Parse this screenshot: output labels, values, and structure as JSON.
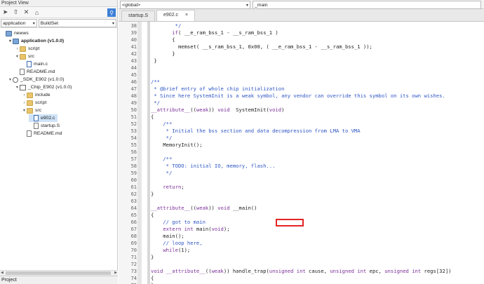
{
  "left": {
    "title": "Project View",
    "combo1": "application",
    "combo2": "BuildSet",
    "bottom_title": "Project",
    "tree": [
      {
        "label": "newws",
        "icon": "workspace",
        "indent": 0,
        "twist": "",
        "bold": false
      },
      {
        "label": "application (v1.0.0)",
        "icon": "project",
        "indent": 1,
        "twist": "▾",
        "bold": true
      },
      {
        "label": "script",
        "icon": "folder",
        "indent": 2,
        "twist": "›",
        "bold": false
      },
      {
        "label": "src",
        "icon": "folder",
        "indent": 2,
        "twist": "▾",
        "bold": false
      },
      {
        "label": "main.c",
        "icon": "cfile",
        "indent": 3,
        "twist": "",
        "bold": false
      },
      {
        "label": "README.md",
        "icon": "file",
        "indent": 2,
        "twist": "",
        "bold": false
      },
      {
        "label": "_SDK_E902 (v1.0.0)",
        "icon": "gear",
        "indent": 1,
        "twist": "▾",
        "bold": false
      },
      {
        "label": "_Chip_E902 (v1.0.0)",
        "icon": "chip",
        "indent": 2,
        "twist": "▾",
        "bold": false
      },
      {
        "label": "include",
        "icon": "folder",
        "indent": 3,
        "twist": "›",
        "bold": false
      },
      {
        "label": "script",
        "icon": "folder",
        "indent": 3,
        "twist": "›",
        "bold": false
      },
      {
        "label": "src",
        "icon": "folder",
        "indent": 3,
        "twist": "▾",
        "bold": false
      },
      {
        "label": "e902.c",
        "icon": "cfile",
        "indent": 4,
        "twist": "",
        "bold": false,
        "selected": true
      },
      {
        "label": "startup.S",
        "icon": "file",
        "indent": 4,
        "twist": "",
        "bold": false
      },
      {
        "label": "README.md",
        "icon": "file",
        "indent": 3,
        "twist": "",
        "bold": false
      }
    ]
  },
  "editor": {
    "scope_combo": "<global>",
    "symbol_combo": "_main",
    "tabs": [
      {
        "label": "startup.S",
        "active": false,
        "closable": false
      },
      {
        "label": "e902.c",
        "active": true,
        "closable": true
      }
    ],
    "close_glyph": "×",
    "lines": [
      {
        "n": "38",
        "html": "        */"
      },
      {
        "n": "39",
        "html": "       if( __e_ram_bss_1 - __s_ram_bss_1 )"
      },
      {
        "n": "40",
        "html": "       {"
      },
      {
        "n": "41",
        "html": "         memset( __s_ram_bss_1, 0x00, ( __e_ram_bss_1 - __s_ram_bss_1 ));"
      },
      {
        "n": "42",
        "html": "       }"
      },
      {
        "n": "43",
        "html": " }"
      },
      {
        "n": "44",
        "html": ""
      },
      {
        "n": "45",
        "html": ""
      },
      {
        "n": "46",
        "html": "/**"
      },
      {
        "n": "47",
        "html": " * @brief entry of whole chip initialization"
      },
      {
        "n": "48",
        "html": " * Since here SystemInit is a weak symbol, any vendor can override this symbol on its own wishes."
      },
      {
        "n": "49",
        "html": " */"
      },
      {
        "n": "50",
        "html": "__attribute__((weak)) void  SystemInit(void)"
      },
      {
        "n": "51",
        "html": "{"
      },
      {
        "n": "52",
        "html": "    /**"
      },
      {
        "n": "53",
        "html": "     * Initial the bss section and data decompression from LMA to VMA"
      },
      {
        "n": "54",
        "html": "     */"
      },
      {
        "n": "55",
        "html": "    MemoryInit();"
      },
      {
        "n": "56",
        "html": ""
      },
      {
        "n": "57",
        "html": "    /**"
      },
      {
        "n": "58",
        "html": "     * TODO: initial IO, memory, flash..."
      },
      {
        "n": "59",
        "html": "     */"
      },
      {
        "n": "60",
        "html": ""
      },
      {
        "n": "61",
        "html": "    return;"
      },
      {
        "n": "62",
        "html": "}"
      },
      {
        "n": "63",
        "html": ""
      },
      {
        "n": "64",
        "html": "__attribute__((weak)) void __main()"
      },
      {
        "n": "65",
        "html": "{"
      },
      {
        "n": "66",
        "html": "    // got to main"
      },
      {
        "n": "67",
        "html": "    extern int main(void);"
      },
      {
        "n": "68",
        "html": "    main();"
      },
      {
        "n": "69",
        "html": "    // loop here,"
      },
      {
        "n": "70",
        "html": "    while(1);"
      },
      {
        "n": "71",
        "html": "}"
      },
      {
        "n": "72",
        "html": ""
      },
      {
        "n": "73",
        "html": "void __attribute__((weak)) handle_trap(unsigned int cause, unsigned int epc, unsigned int regs[32])"
      },
      {
        "n": "74",
        "html": "{"
      },
      {
        "n": "75",
        "html": "}"
      },
      {
        "n": "76",
        "html": ""
      }
    ]
  },
  "colors": {
    "comment": "#2f56c4",
    "keyword": "#7b2f9a",
    "highlight_box": "#e22424",
    "selection": "#cfe3f8"
  }
}
